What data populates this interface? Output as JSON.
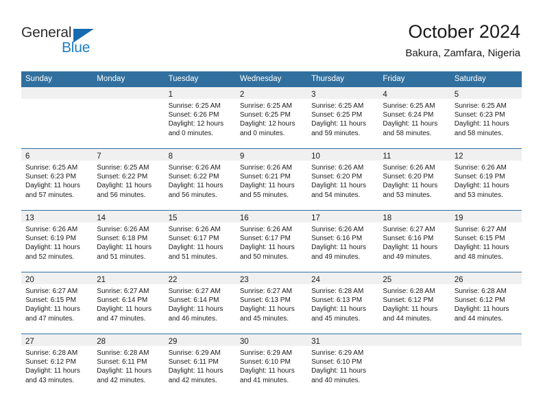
{
  "brand": {
    "name_top": "General",
    "name_bottom": "Blue",
    "triangle_color": "#176bb0",
    "blue_text_color": "#1b7fc4"
  },
  "header": {
    "title": "October 2024",
    "subtitle": "Bakura, Zamfara, Nigeria"
  },
  "colors": {
    "header_row_bg": "#31709e",
    "header_row_text": "#ffffff",
    "day_band_bg": "#f0f0f0",
    "row_separator": "#2e6da4",
    "page_bg": "#ffffff",
    "text": "#1a1a1a"
  },
  "weekday_headers": [
    "Sunday",
    "Monday",
    "Tuesday",
    "Wednesday",
    "Thursday",
    "Friday",
    "Saturday"
  ],
  "labels": {
    "sunrise_prefix": "Sunrise:",
    "sunset_prefix": "Sunset:",
    "daylight_prefix": "Daylight:"
  },
  "weeks": [
    [
      {
        "day": "",
        "line1": "",
        "line2": "",
        "line3": "",
        "line4": ""
      },
      {
        "day": "",
        "line1": "",
        "line2": "",
        "line3": "",
        "line4": ""
      },
      {
        "day": "1",
        "line1": "Sunrise: 6:25 AM",
        "line2": "Sunset: 6:26 PM",
        "line3": "Daylight: 12 hours",
        "line4": "and 0 minutes."
      },
      {
        "day": "2",
        "line1": "Sunrise: 6:25 AM",
        "line2": "Sunset: 6:25 PM",
        "line3": "Daylight: 12 hours",
        "line4": "and 0 minutes."
      },
      {
        "day": "3",
        "line1": "Sunrise: 6:25 AM",
        "line2": "Sunset: 6:25 PM",
        "line3": "Daylight: 11 hours",
        "line4": "and 59 minutes."
      },
      {
        "day": "4",
        "line1": "Sunrise: 6:25 AM",
        "line2": "Sunset: 6:24 PM",
        "line3": "Daylight: 11 hours",
        "line4": "and 58 minutes."
      },
      {
        "day": "5",
        "line1": "Sunrise: 6:25 AM",
        "line2": "Sunset: 6:23 PM",
        "line3": "Daylight: 11 hours",
        "line4": "and 58 minutes."
      }
    ],
    [
      {
        "day": "6",
        "line1": "Sunrise: 6:25 AM",
        "line2": "Sunset: 6:23 PM",
        "line3": "Daylight: 11 hours",
        "line4": "and 57 minutes."
      },
      {
        "day": "7",
        "line1": "Sunrise: 6:25 AM",
        "line2": "Sunset: 6:22 PM",
        "line3": "Daylight: 11 hours",
        "line4": "and 56 minutes."
      },
      {
        "day": "8",
        "line1": "Sunrise: 6:26 AM",
        "line2": "Sunset: 6:22 PM",
        "line3": "Daylight: 11 hours",
        "line4": "and 56 minutes."
      },
      {
        "day": "9",
        "line1": "Sunrise: 6:26 AM",
        "line2": "Sunset: 6:21 PM",
        "line3": "Daylight: 11 hours",
        "line4": "and 55 minutes."
      },
      {
        "day": "10",
        "line1": "Sunrise: 6:26 AM",
        "line2": "Sunset: 6:20 PM",
        "line3": "Daylight: 11 hours",
        "line4": "and 54 minutes."
      },
      {
        "day": "11",
        "line1": "Sunrise: 6:26 AM",
        "line2": "Sunset: 6:20 PM",
        "line3": "Daylight: 11 hours",
        "line4": "and 53 minutes."
      },
      {
        "day": "12",
        "line1": "Sunrise: 6:26 AM",
        "line2": "Sunset: 6:19 PM",
        "line3": "Daylight: 11 hours",
        "line4": "and 53 minutes."
      }
    ],
    [
      {
        "day": "13",
        "line1": "Sunrise: 6:26 AM",
        "line2": "Sunset: 6:19 PM",
        "line3": "Daylight: 11 hours",
        "line4": "and 52 minutes."
      },
      {
        "day": "14",
        "line1": "Sunrise: 6:26 AM",
        "line2": "Sunset: 6:18 PM",
        "line3": "Daylight: 11 hours",
        "line4": "and 51 minutes."
      },
      {
        "day": "15",
        "line1": "Sunrise: 6:26 AM",
        "line2": "Sunset: 6:17 PM",
        "line3": "Daylight: 11 hours",
        "line4": "and 51 minutes."
      },
      {
        "day": "16",
        "line1": "Sunrise: 6:26 AM",
        "line2": "Sunset: 6:17 PM",
        "line3": "Daylight: 11 hours",
        "line4": "and 50 minutes."
      },
      {
        "day": "17",
        "line1": "Sunrise: 6:26 AM",
        "line2": "Sunset: 6:16 PM",
        "line3": "Daylight: 11 hours",
        "line4": "and 49 minutes."
      },
      {
        "day": "18",
        "line1": "Sunrise: 6:27 AM",
        "line2": "Sunset: 6:16 PM",
        "line3": "Daylight: 11 hours",
        "line4": "and 49 minutes."
      },
      {
        "day": "19",
        "line1": "Sunrise: 6:27 AM",
        "line2": "Sunset: 6:15 PM",
        "line3": "Daylight: 11 hours",
        "line4": "and 48 minutes."
      }
    ],
    [
      {
        "day": "20",
        "line1": "Sunrise: 6:27 AM",
        "line2": "Sunset: 6:15 PM",
        "line3": "Daylight: 11 hours",
        "line4": "and 47 minutes."
      },
      {
        "day": "21",
        "line1": "Sunrise: 6:27 AM",
        "line2": "Sunset: 6:14 PM",
        "line3": "Daylight: 11 hours",
        "line4": "and 47 minutes."
      },
      {
        "day": "22",
        "line1": "Sunrise: 6:27 AM",
        "line2": "Sunset: 6:14 PM",
        "line3": "Daylight: 11 hours",
        "line4": "and 46 minutes."
      },
      {
        "day": "23",
        "line1": "Sunrise: 6:27 AM",
        "line2": "Sunset: 6:13 PM",
        "line3": "Daylight: 11 hours",
        "line4": "and 45 minutes."
      },
      {
        "day": "24",
        "line1": "Sunrise: 6:28 AM",
        "line2": "Sunset: 6:13 PM",
        "line3": "Daylight: 11 hours",
        "line4": "and 45 minutes."
      },
      {
        "day": "25",
        "line1": "Sunrise: 6:28 AM",
        "line2": "Sunset: 6:12 PM",
        "line3": "Daylight: 11 hours",
        "line4": "and 44 minutes."
      },
      {
        "day": "26",
        "line1": "Sunrise: 6:28 AM",
        "line2": "Sunset: 6:12 PM",
        "line3": "Daylight: 11 hours",
        "line4": "and 44 minutes."
      }
    ],
    [
      {
        "day": "27",
        "line1": "Sunrise: 6:28 AM",
        "line2": "Sunset: 6:12 PM",
        "line3": "Daylight: 11 hours",
        "line4": "and 43 minutes."
      },
      {
        "day": "28",
        "line1": "Sunrise: 6:28 AM",
        "line2": "Sunset: 6:11 PM",
        "line3": "Daylight: 11 hours",
        "line4": "and 42 minutes."
      },
      {
        "day": "29",
        "line1": "Sunrise: 6:29 AM",
        "line2": "Sunset: 6:11 PM",
        "line3": "Daylight: 11 hours",
        "line4": "and 42 minutes."
      },
      {
        "day": "30",
        "line1": "Sunrise: 6:29 AM",
        "line2": "Sunset: 6:10 PM",
        "line3": "Daylight: 11 hours",
        "line4": "and 41 minutes."
      },
      {
        "day": "31",
        "line1": "Sunrise: 6:29 AM",
        "line2": "Sunset: 6:10 PM",
        "line3": "Daylight: 11 hours",
        "line4": "and 40 minutes."
      },
      {
        "day": "",
        "line1": "",
        "line2": "",
        "line3": "",
        "line4": ""
      },
      {
        "day": "",
        "line1": "",
        "line2": "",
        "line3": "",
        "line4": ""
      }
    ]
  ]
}
